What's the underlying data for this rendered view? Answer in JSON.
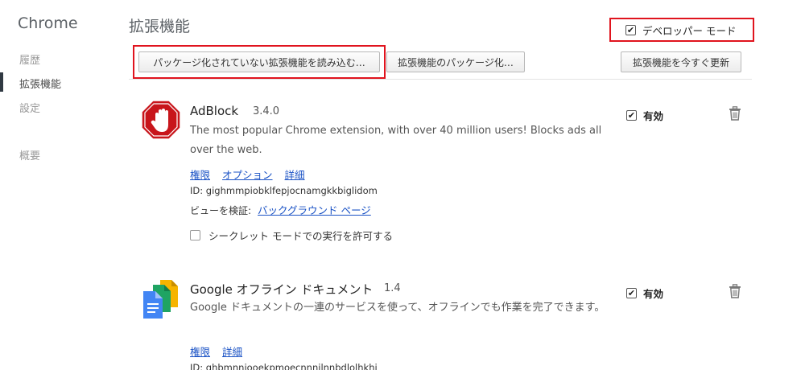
{
  "app": {
    "title": "Chrome"
  },
  "sidebar": {
    "items": [
      {
        "label": "履歴"
      },
      {
        "label": "拡張機能"
      },
      {
        "label": "設定"
      },
      {
        "label": "概要"
      }
    ]
  },
  "header": {
    "title": "拡張機能",
    "developer_mode": {
      "label": "デベロッパー モード",
      "checked": true
    }
  },
  "toolbar": {
    "load_unpacked": "パッケージ化されていない拡張機能を読み込む…",
    "pack_extension": "拡張機能のパッケージ化…",
    "update_now": "拡張機能を今すぐ更新"
  },
  "extensions": [
    {
      "name": "AdBlock",
      "version": "3.4.0",
      "description": "The most popular Chrome extension, with over 40 million users! Blocks ads all over the web.",
      "links": [
        "権限",
        "オプション",
        "詳細"
      ],
      "id_text": "ID: gighmmpiobklfepjocnamgkkbiglidom",
      "inspect_label": "ビューを検証:",
      "inspect_link": "バックグラウンド ページ",
      "incognito_label": "シークレット モードでの実行を許可する",
      "incognito_checked": false,
      "enabled_label": "有効",
      "enabled": true,
      "icon": "stop-hand-icon"
    },
    {
      "name": "Google オフライン ドキュメント",
      "version": "1.4",
      "description": "Google ドキュメントの一連のサービスを使って、オフラインでも作業を完了できます。",
      "links": [
        "権限",
        "詳細"
      ],
      "id_text": "ID: ghbmnnjooekpmoecnnnilnnbdlolhkhi",
      "enabled_label": "有効",
      "enabled": true,
      "icon": "google-docs-icon"
    }
  ],
  "colors": {
    "highlight_box": "#e0141e",
    "link": "#1a52c5",
    "adblock_red": "#c8151b"
  }
}
